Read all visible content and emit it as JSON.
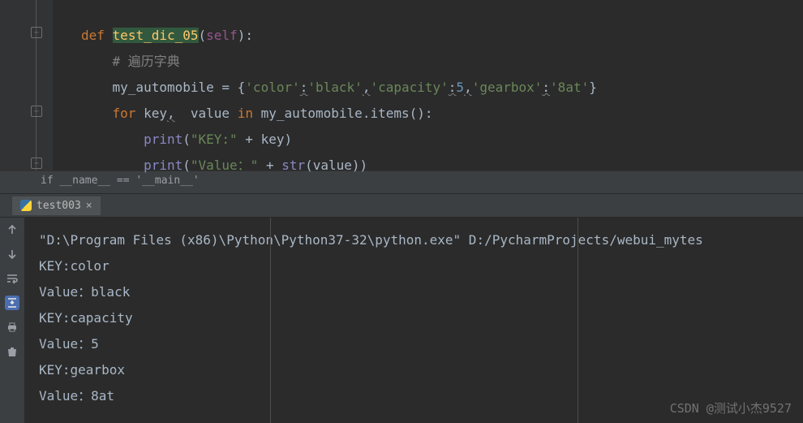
{
  "code": {
    "def": "def",
    "func_name": "test_dic_05",
    "self": "self",
    "comment": "# 遍历字典",
    "assign_var": "my_automobile = {",
    "s_color": "'color'",
    "s_black": "'black'",
    "s_capacity": "'capacity'",
    "n_5": "5",
    "s_gearbox": "'gearbox'",
    "s_8at": "'8at'",
    "close_brace": "}",
    "for": "for",
    "key_var": "key",
    "comma_wavy": ",",
    "value_var": "  value ",
    "in": "in",
    "loop_iter": " my_automobile.items():",
    "print1_a": "print",
    "print1_b": "(",
    "print1_str": "\"KEY:\"",
    "print1_c": " + key)",
    "print2_a": "print",
    "print2_b": "(",
    "print2_str": "\"Value：\"",
    "print2_c": " + ",
    "str_fn": "str",
    "print2_d": "(value))"
  },
  "breadcrumb": "if __name__ == '__main__'",
  "tab": {
    "label": "test003"
  },
  "console": {
    "cmd": "\"D:\\Program Files (x86)\\Python\\Python37-32\\python.exe\" D:/PycharmProjects/webui_mytes",
    "l1": "KEY:color",
    "l2": "Value：black",
    "l3": "KEY:capacity",
    "l4": "Value：5",
    "l5": "KEY:gearbox",
    "l6": "Value：8at"
  },
  "watermark": "CSDN @测试小杰9527"
}
